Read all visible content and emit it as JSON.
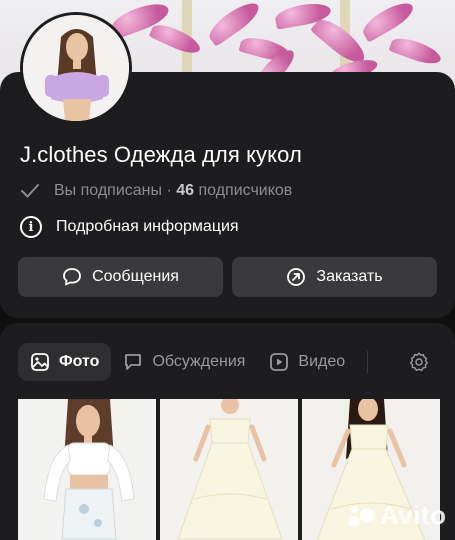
{
  "profile": {
    "title": "J.clothes Одежда для кукол",
    "subscribed_label": "Вы подписаны ·",
    "subscribers_count": "46",
    "subscribers_label": "подписчиков",
    "info_label": "Подробная информация",
    "info_icon": "i"
  },
  "actions": {
    "messages_label": "Сообщения",
    "order_label": "Заказать"
  },
  "tabs": [
    {
      "label": "Фото",
      "icon": "image-icon",
      "active": true
    },
    {
      "label": "Обсуждения",
      "icon": "chat-icon",
      "active": false
    },
    {
      "label": "Видео",
      "icon": "video-icon",
      "active": false
    }
  ],
  "watermark": {
    "text": "Avito"
  },
  "colors": {
    "background": "#0f0f10",
    "card": "#1d1d1f",
    "button": "#3a3a3d",
    "muted_text": "#8d8d93"
  }
}
